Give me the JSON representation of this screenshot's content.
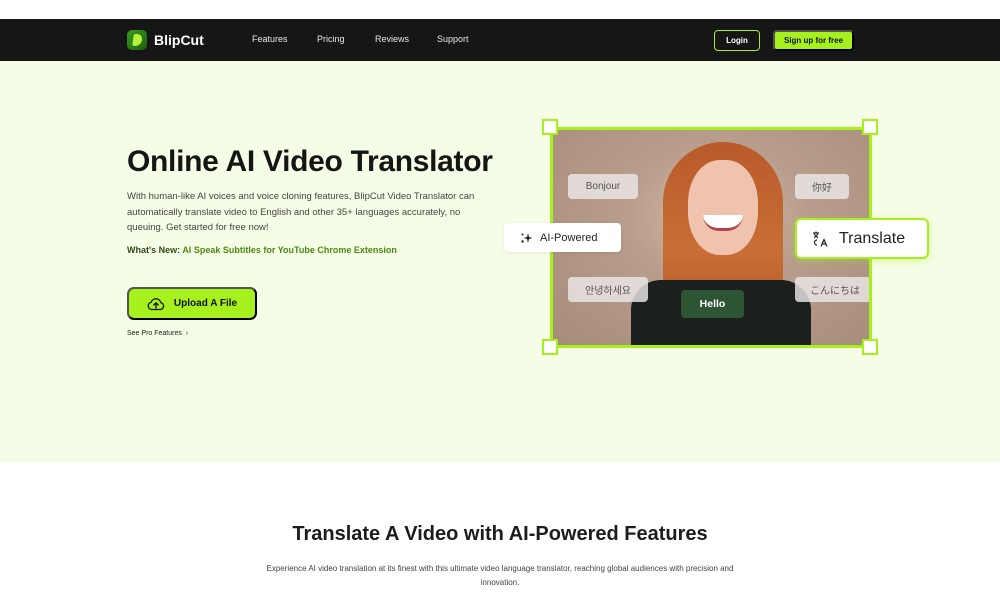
{
  "nav": {
    "brand": "BlipCut",
    "links": [
      "Features",
      "Pricing",
      "Reviews",
      "Support"
    ],
    "login_label": "Login",
    "signup_label": "Sign up for free"
  },
  "hero": {
    "title": "Online AI Video Translator",
    "description": "With human-like AI voices and voice cloning features, BlipCut Video Translator can automatically translate video to English and other 35+ languages accurately, no queuing. Get started for free now!",
    "whats_new_label": "What's New: ",
    "whats_new_link": "AI Speak Subtitles for YouTube Chrome Extension",
    "upload_label": "Upload A File",
    "see_pro_label": "See Pro Features",
    "media": {
      "bubbles": {
        "french": "Bonjour",
        "chinese": "你好",
        "korean": "안녕하세요",
        "japanese": "こんにちは",
        "english": "Hello"
      },
      "ai_chip_label": "AI-Powered",
      "translate_chip_label": "Translate"
    }
  },
  "features_section": {
    "title": "Translate A Video with AI-Powered Features",
    "description": "Experience AI video translation at its finest with this ultimate video language translator, reaching global audiences with precision and innovation."
  },
  "colors": {
    "accent": "#a6f01e",
    "nav_bg": "#161616",
    "hero_bg": "#f6fde6",
    "link_green": "#4b8a12",
    "hello_bg": "#2d5534"
  }
}
